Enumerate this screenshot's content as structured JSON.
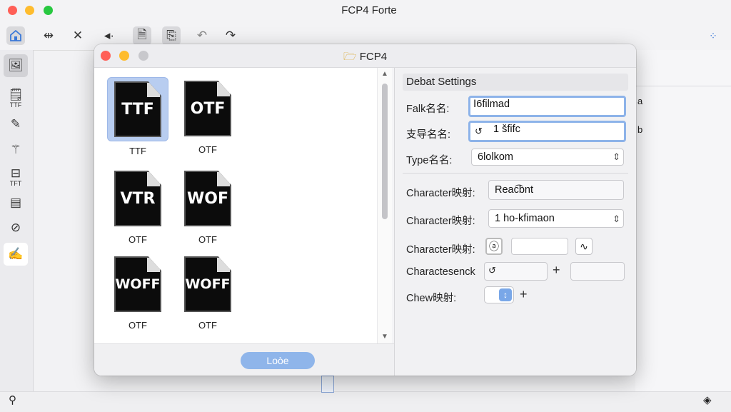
{
  "app": {
    "title": "FCP4 Forte",
    "colors": {
      "close": "#ff5f57",
      "minimize": "#febc2e",
      "zoom": "#28c840",
      "accent": "#8fb5ea"
    }
  },
  "toolbar": {
    "icons": [
      "home-icon",
      "collapse-icon",
      "close-icon",
      "play-back-icon",
      "document-icon",
      "export-icon",
      "undo-icon",
      "redo-icon",
      "grid-icon"
    ]
  },
  "sidebar": {
    "items": [
      {
        "icon": "image-edit-icon",
        "label": ""
      },
      {
        "icon": "ttf-file-icon",
        "label": "TTF"
      },
      {
        "icon": "pencil-icon",
        "label": ""
      },
      {
        "icon": "magic-wand-icon",
        "label": ""
      },
      {
        "icon": "tft-icon",
        "label": "TFT"
      },
      {
        "icon": "panel-icon",
        "label": ""
      },
      {
        "icon": "brush-icon",
        "label": ""
      },
      {
        "icon": "sign-icon",
        "label": ""
      }
    ]
  },
  "right_panel": {
    "text1": "a",
    "text2": "b"
  },
  "dialog": {
    "title": "FCP4",
    "title_icon": "folder-icon",
    "files": [
      {
        "badge": "TTF",
        "label": "TTF",
        "selected": true
      },
      {
        "badge": "OTF",
        "label": "OTF",
        "selected": false
      },
      {
        "badge": "VTR",
        "label": "OTF",
        "selected": false
      },
      {
        "badge": "WOF",
        "label": "OTF",
        "selected": false
      },
      {
        "badge": "WOFF",
        "label": "OTF",
        "selected": false
      },
      {
        "badge": "WOFF",
        "label": "OTF",
        "selected": false
      }
    ],
    "load_button": "Loòe",
    "settings": {
      "header": "Debat Settings",
      "rows": [
        {
          "label": "Falk名名:",
          "value": "Ⅰ6filmad"
        },
        {
          "label": "支导名名:",
          "value": "1 šfifc"
        },
        {
          "label": "Type名名:",
          "value": "6lolkom"
        },
        {
          "label": "Character映射:",
          "value": "Reac͡bnt"
        },
        {
          "label": "Character映射:",
          "value": "1 ho-kfimaon"
        },
        {
          "label": "Character映射:",
          "value": ""
        },
        {
          "label": "Charactesenck",
          "value": ""
        },
        {
          "label": "Chew映射:",
          "value": ""
        }
      ],
      "plus_label": "+"
    }
  }
}
